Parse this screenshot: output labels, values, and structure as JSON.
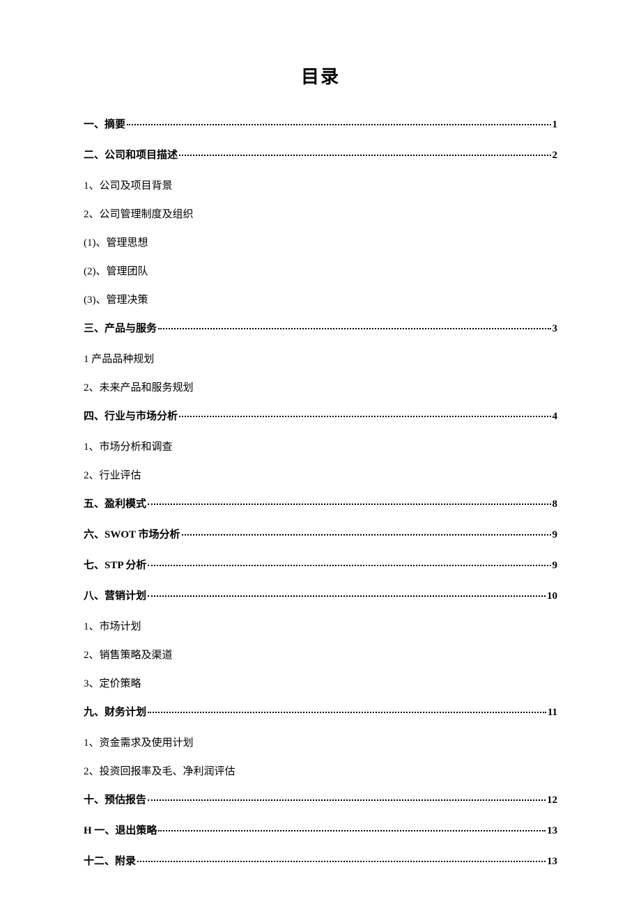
{
  "title": "目录",
  "entries": [
    {
      "type": "main",
      "label": "一、摘要",
      "page": "1"
    },
    {
      "type": "main",
      "label": "二、公司和项目描述",
      "page": "2"
    },
    {
      "type": "sub",
      "label": "1、公司及项目背景"
    },
    {
      "type": "sub",
      "label": "2、公司管理制度及组织"
    },
    {
      "type": "sub",
      "label": "(1)、管理思想"
    },
    {
      "type": "sub",
      "label": "(2)、管理团队"
    },
    {
      "type": "sub",
      "label": "(3)、管理决策"
    },
    {
      "type": "main",
      "label": "三、产品与服务",
      "page": "3"
    },
    {
      "type": "sub",
      "label": "1 产品品种规划"
    },
    {
      "type": "sub",
      "label": "2、未来产品和服务规划"
    },
    {
      "type": "main",
      "label": "四、行业与市场分析",
      "page": "4"
    },
    {
      "type": "sub",
      "label": "1、市场分析和调查"
    },
    {
      "type": "sub",
      "label": "2、行业评估"
    },
    {
      "type": "main",
      "label": "五、盈利模式",
      "page": "8"
    },
    {
      "type": "main",
      "label": "六、SWOT 市场分析",
      "page": "9"
    },
    {
      "type": "main",
      "label": "七、STP 分析",
      "page": "9"
    },
    {
      "type": "main",
      "label": "八、营销计划",
      "page": "10"
    },
    {
      "type": "sub",
      "label": "1、市场计划"
    },
    {
      "type": "sub",
      "label": "2、销售策略及渠道"
    },
    {
      "type": "sub",
      "label": "3、定价策略"
    },
    {
      "type": "main",
      "label": "九、财务计划",
      "page": "11"
    },
    {
      "type": "sub",
      "label": "1、资金需求及使用计划"
    },
    {
      "type": "sub",
      "label": "2、投资回报率及毛、净利润评估"
    },
    {
      "type": "main",
      "label": "十、预估报告",
      "page": "12"
    },
    {
      "type": "main",
      "label": "H 一、退出策略",
      "page": "13"
    },
    {
      "type": "main",
      "label": "十二、附录",
      "page": "13"
    }
  ]
}
